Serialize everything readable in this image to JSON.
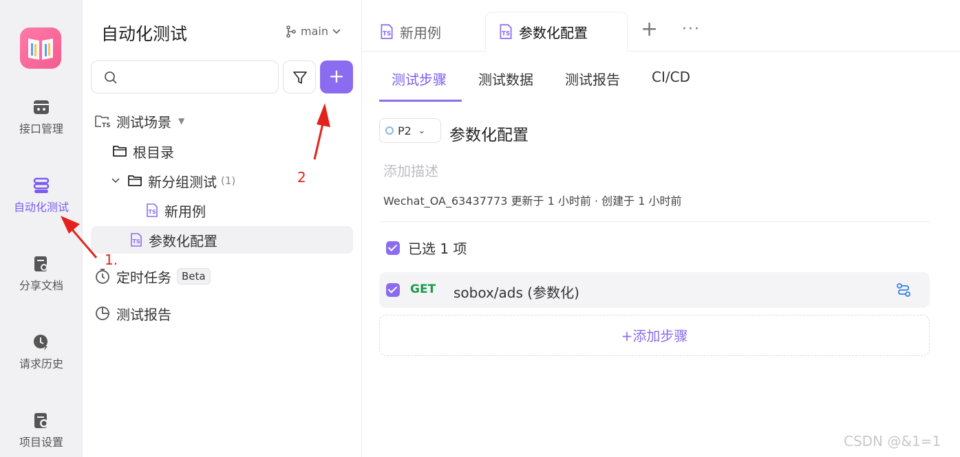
{
  "rail": {
    "items": [
      {
        "label": "接口管理",
        "icon": "api-management-icon"
      },
      {
        "label": "自动化测试",
        "icon": "automation-test-icon"
      },
      {
        "label": "分享文档",
        "icon": "share-doc-icon"
      },
      {
        "label": "请求历史",
        "icon": "request-history-icon"
      },
      {
        "label": "项目设置",
        "icon": "project-settings-icon"
      }
    ]
  },
  "sidebar": {
    "title": "自动化测试",
    "branch": "main",
    "add_symbol": "+",
    "tree": {
      "scenarios": "测试场景",
      "root": "根目录",
      "group": "新分组测试",
      "group_count": "(1)",
      "case_new": "新用例",
      "case_param": "参数化配置",
      "scheduled": "定时任务",
      "beta": "Beta",
      "reports": "测试报告"
    }
  },
  "tabs": {
    "tab1": "新用例",
    "tab2": "参数化配置",
    "plus": "+",
    "more": "···"
  },
  "subtabs": [
    "测试步骤",
    "测试数据",
    "测试报告",
    "CI/CD"
  ],
  "detail": {
    "priority": "P2",
    "title": "参数化配置",
    "desc_placeholder": "添加描述",
    "meta": "Wechat_OA_63437773 更新于 1 小时前 · 创建于 1 小时前",
    "selected": "已选 1 项",
    "step_method": "GET",
    "step_path": "sobox/ads (参数化)",
    "add_step": "+添加步骤"
  },
  "annotations": {
    "a1": "1.",
    "a2": "2"
  },
  "watermark": "CSDN @&1=1",
  "colors": {
    "accent": "#8b6cf0",
    "get": "#1a9a4a",
    "annotation": "#e3221b"
  }
}
